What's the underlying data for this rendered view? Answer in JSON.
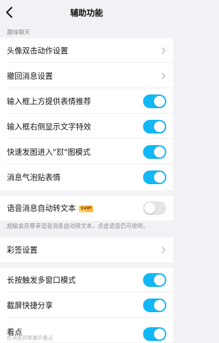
{
  "header": {
    "title": "辅助功能",
    "back_icon": "chevron-left-icon"
  },
  "section_fun_chat": {
    "title": "趣味聊天"
  },
  "rows": {
    "avatar_double_click": {
      "label": "头像双击动作设置"
    },
    "recall_message": {
      "label": "撤回消息设置"
    },
    "emoji_recommend": {
      "label": "输入框上方提供表情推荐",
      "on": true
    },
    "text_effect": {
      "label": "输入框右侧显示文字特效",
      "on": true
    },
    "duitu_mode": {
      "label": "快速发图进入\"怼\"图模式",
      "on": true
    },
    "bubble_sticker": {
      "label": "消息气泡贴表情",
      "on": true
    },
    "voice_to_text": {
      "label": "语音消息自动转文本",
      "badge": "SVIP",
      "on": false
    },
    "caiqian": {
      "label": "彩签设置"
    },
    "multi_window": {
      "label": "长按触发多窗口模式",
      "on": true
    },
    "screenshot_share": {
      "label": "截屏快捷分享",
      "on": true
    },
    "kandian": {
      "label": "看点",
      "sub": "在消息列表展示看点",
      "on": true
    }
  },
  "voice_note": "超级会员尊享语音消息自动转文本，点击语音仍可收听。",
  "colors": {
    "accent": "#12b7f5",
    "background": "#f2f2f6",
    "toggle_off": "#e6e6ea"
  }
}
